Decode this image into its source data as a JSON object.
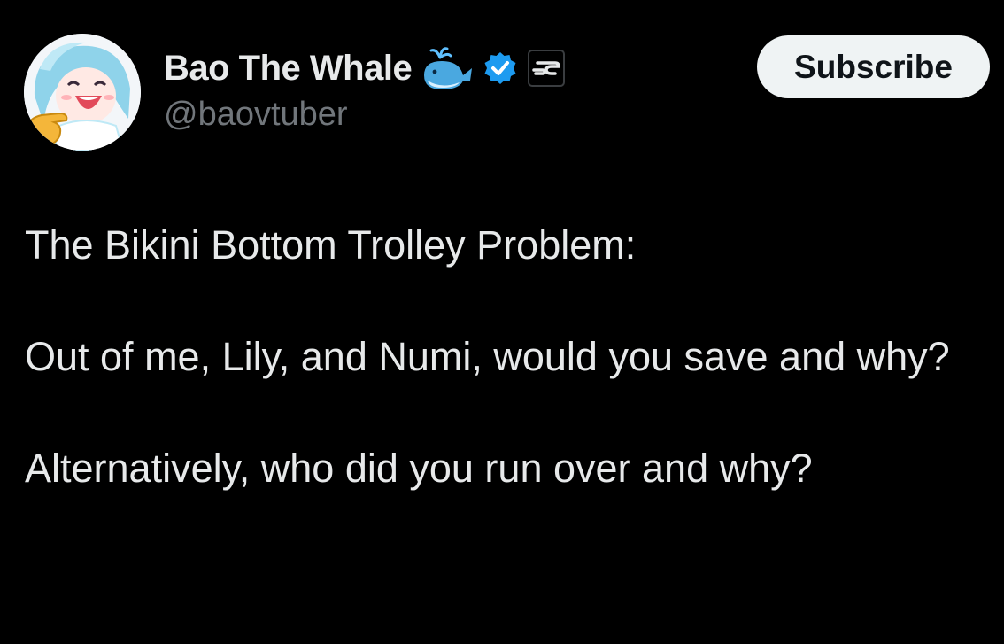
{
  "author": {
    "display_name": "Bao The Whale",
    "handle": "@baovtuber",
    "avatar_icon": "anime-whale-girl-avatar",
    "badges": [
      "whale-emoji-icon",
      "verified-badge-icon",
      "subscriber-badge-icon"
    ]
  },
  "actions": {
    "subscribe_label": "Subscribe"
  },
  "tweet": {
    "paragraphs": [
      "The Bikini Bottom Trolley Problem:",
      "Out of me, Lily, and Numi, would you save and why?",
      "Alternatively, who did you run over and why?"
    ]
  },
  "colors": {
    "background": "#000000",
    "text_primary": "#e7e9ea",
    "text_secondary": "#71767b",
    "verified_blue": "#1d9bf0",
    "button_bg": "#eff3f4"
  }
}
